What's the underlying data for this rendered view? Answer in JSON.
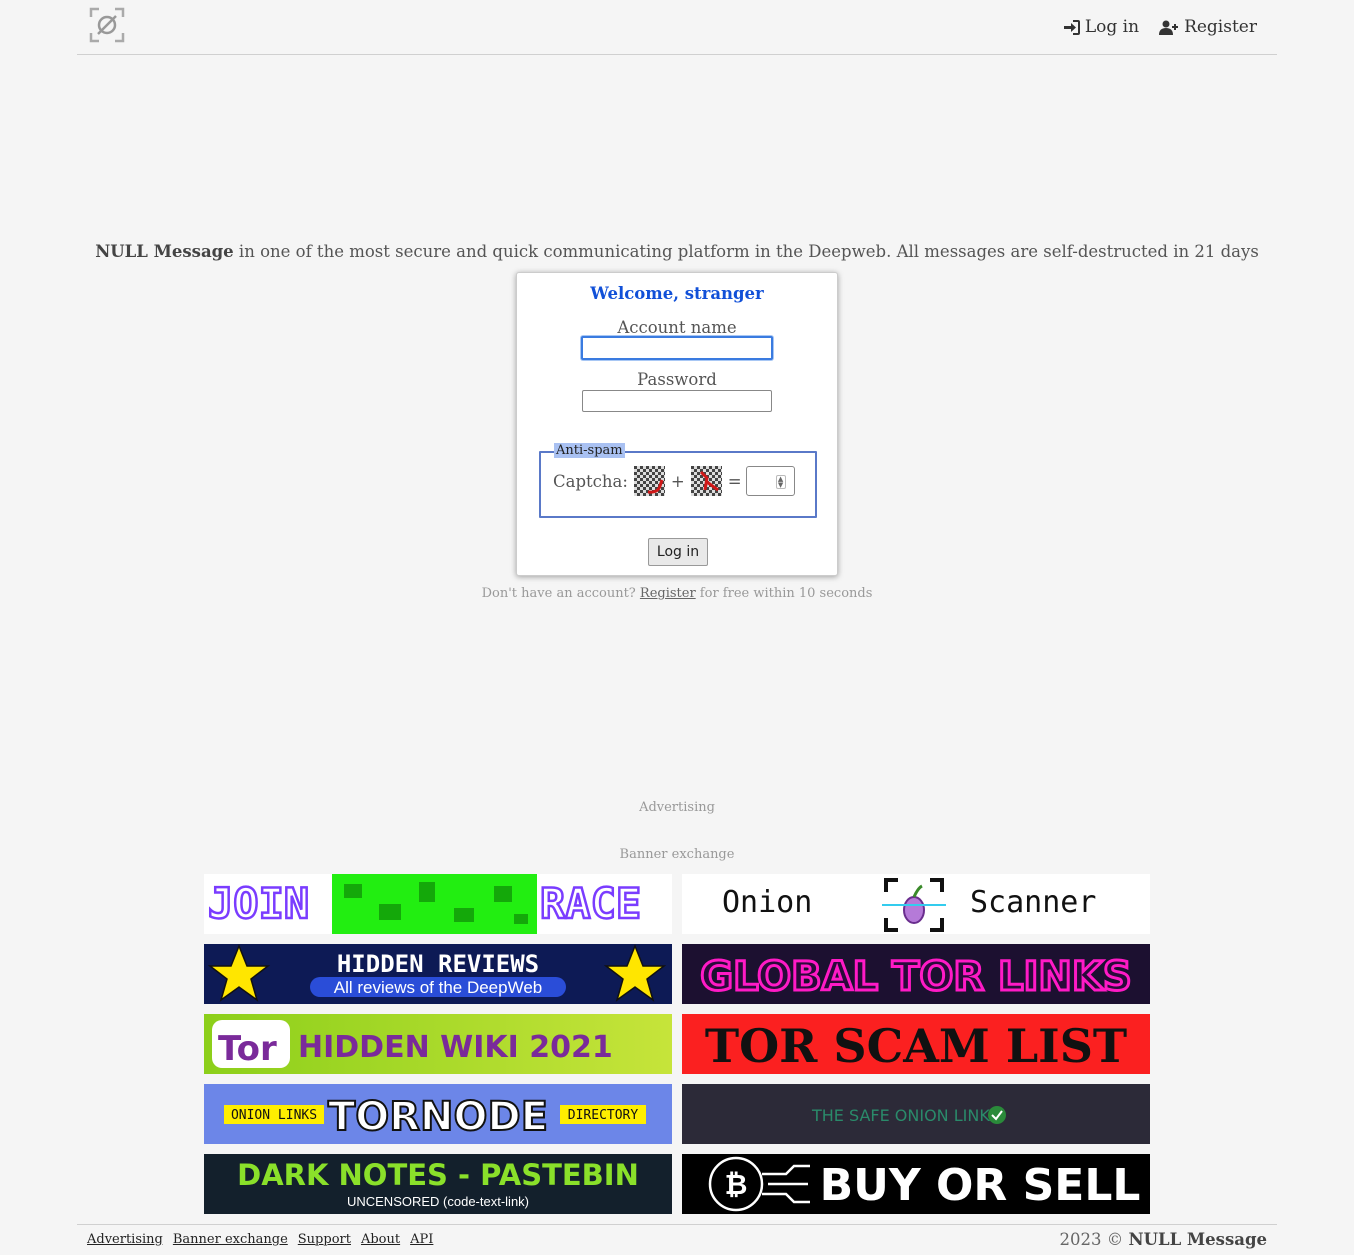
{
  "header": {
    "nav": {
      "login": "Log in",
      "register": "Register"
    }
  },
  "tagline": {
    "brand": "NULL Message",
    "text": " in one of the most secure and quick communicating platform in the Deepweb. All messages are self-destructed in 21 days"
  },
  "login_card": {
    "welcome": "Welcome, stranger",
    "account_label": "Account name",
    "account_value": "",
    "password_label": "Password",
    "password_value": "",
    "antispam_legend": "Anti-spam",
    "captcha_label": "Captcha:",
    "plus": "+",
    "equals": "=",
    "captcha_answer": "",
    "submit": "Log in"
  },
  "signup": {
    "prefix": "Don't have an account? ",
    "link": "Register",
    "suffix": " for free within 10 seconds"
  },
  "ads": {
    "advertising": "Advertising",
    "banner_exchange": "Banner exchange"
  },
  "banners": {
    "join_left": "JOIN",
    "join_right": "RACE",
    "onion_left": "Onion",
    "onion_right": "Scanner",
    "hidden_title": "HIDDEN REVIEWS",
    "hidden_sub": "All reviews of the DeepWeb",
    "global": "GLOBAL TOR LINKS",
    "wiki_logo": "Tor",
    "wiki": "HIDDEN WIKI 2021",
    "scam": "TOR SCAM LIST",
    "tornode_left": "ONION LINKS",
    "tornode_mid": "TORNODE",
    "tornode_right": "DIRECTORY",
    "safe": "THE SAFE ONION LINKS",
    "dark_title": "DARK NOTES - PASTEBIN",
    "dark_sub": "UNCENSORED (code-text-link)",
    "buy": "BUY OR SELL"
  },
  "footer": {
    "links": [
      "Advertising",
      "Banner exchange",
      "Support",
      "About",
      "API"
    ],
    "year": "2023 ©",
    "brand": "NULL Message"
  },
  "colors": {
    "accent": "#1150d8",
    "background": "#f5f5f5",
    "fieldset_border": "#5a79c8"
  }
}
